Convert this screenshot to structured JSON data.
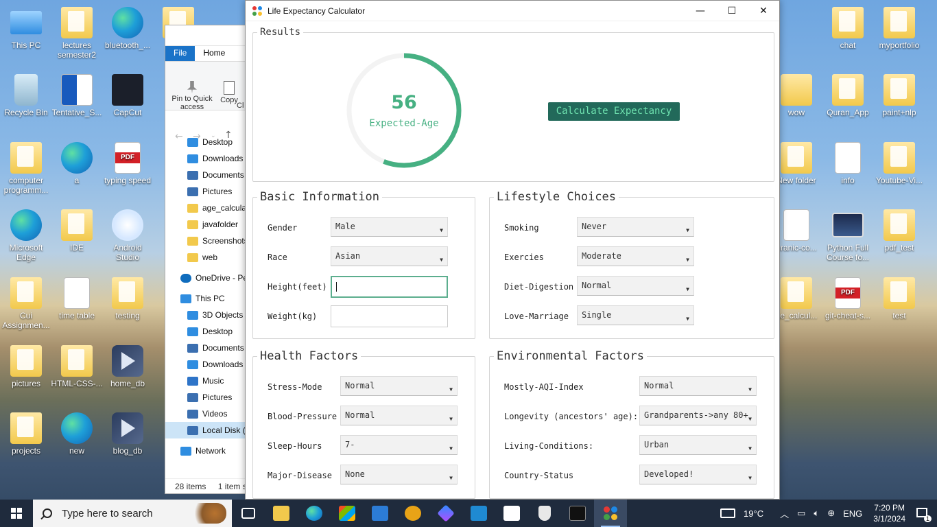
{
  "desktop": {
    "icons_left": [
      {
        "label": "This PC",
        "type": "pc"
      },
      {
        "label": "lectures semester2",
        "type": "folder"
      },
      {
        "label": "bluetooth_...",
        "type": "edge"
      },
      {
        "label": "p",
        "type": "folder"
      },
      {
        "label": "Recycle Bin",
        "type": "bin"
      },
      {
        "label": "Tentative_S...",
        "type": "word"
      },
      {
        "label": "CapCut",
        "type": "dark"
      },
      {
        "label": "computer programm...",
        "type": "folder"
      },
      {
        "label": "a",
        "type": "edge"
      },
      {
        "label": "typing speed",
        "type": "pdf"
      },
      {
        "label": "Microsoft Edge",
        "type": "edge"
      },
      {
        "label": "IDE",
        "type": "folder"
      },
      {
        "label": "Android Studio",
        "type": "studio"
      },
      {
        "label": "Cui Assignmen...",
        "type": "folder"
      },
      {
        "label": "time table",
        "type": "doc"
      },
      {
        "label": "testing",
        "type": "folder"
      },
      {
        "label": "pictures",
        "type": "folder"
      },
      {
        "label": "HTML-CSS-...",
        "type": "folder"
      },
      {
        "label": "home_db",
        "type": "gem"
      },
      {
        "label": "projects",
        "type": "folder"
      },
      {
        "label": "new",
        "type": "edge"
      },
      {
        "label": "blog_db",
        "type": "gem"
      }
    ],
    "icons_right": [
      {
        "label": "chat",
        "type": "folder"
      },
      {
        "label": "myportfolio",
        "type": "folder"
      },
      {
        "label": "wow",
        "type": "js"
      },
      {
        "label": "Quran_App",
        "type": "folder"
      },
      {
        "label": "paint+nlp",
        "type": "folder"
      },
      {
        "label": "New folder",
        "type": "folder"
      },
      {
        "label": "info",
        "type": "doc"
      },
      {
        "label": "Youtube-Vi...",
        "type": "folder"
      },
      {
        "label": "uranic-co...",
        "type": "doc"
      },
      {
        "label": "Python Full Course fo...",
        "type": "vid"
      },
      {
        "label": "pdf_test",
        "type": "folder"
      },
      {
        "label": "ge_calcul...",
        "type": "folder"
      },
      {
        "label": "git-cheat-s...",
        "type": "pdf"
      },
      {
        "label": "test",
        "type": "folder"
      }
    ]
  },
  "explorer": {
    "tabs": [
      "File",
      "Home"
    ],
    "ribbon": {
      "pin": "Pin to Quick access",
      "copy": "Copy",
      "cl": "Cl"
    },
    "nav_items": [
      {
        "label": "Desktop",
        "icon": "blue",
        "top": false
      },
      {
        "label": "Downloads",
        "icon": "blue",
        "top": false
      },
      {
        "label": "Documents",
        "icon": "gray",
        "top": false
      },
      {
        "label": "Pictures",
        "icon": "gray",
        "top": false
      },
      {
        "label": "age_calculat",
        "icon": "folder",
        "top": false
      },
      {
        "label": "javafolder",
        "icon": "folder",
        "top": false
      },
      {
        "label": "Screenshots",
        "icon": "folder",
        "top": false
      },
      {
        "label": "web",
        "icon": "folder",
        "top": false
      },
      {
        "label": "OneDrive - Pe",
        "icon": "cloud",
        "top": true
      },
      {
        "label": "This PC",
        "icon": "blue",
        "top": true
      },
      {
        "label": "3D Objects",
        "icon": "blue",
        "top": false
      },
      {
        "label": "Desktop",
        "icon": "blue",
        "top": false
      },
      {
        "label": "Documents",
        "icon": "gray",
        "top": false
      },
      {
        "label": "Downloads",
        "icon": "blue",
        "top": false
      },
      {
        "label": "Music",
        "icon": "music",
        "top": false
      },
      {
        "label": "Pictures",
        "icon": "gray",
        "top": false
      },
      {
        "label": "Videos",
        "icon": "gray",
        "top": false
      },
      {
        "label": "Local Disk (C",
        "icon": "gray",
        "top": false,
        "selected": true
      },
      {
        "label": "Network",
        "icon": "blue",
        "top": true
      }
    ],
    "status": {
      "items": "28 items",
      "selected": "1 item s"
    }
  },
  "app": {
    "title": "Life Expectancy Calculator",
    "window_buttons": {
      "minimize": "—",
      "maximize": "☐",
      "close": "✕"
    },
    "results": {
      "legend": "Results",
      "value": "56",
      "label": "Expected-Age",
      "progress_fraction": 0.56,
      "button": "Calculate Expectancy"
    },
    "basic": {
      "legend": "Basic Information",
      "gender_label": "Gender",
      "gender_value": "Male",
      "race_label": "Race",
      "race_value": "Asian",
      "height_label": "Height(feet)",
      "height_value": "",
      "weight_label": "Weight(kg)",
      "weight_value": ""
    },
    "lifestyle": {
      "legend": "Lifestyle Choices",
      "smoking_label": "Smoking",
      "smoking_value": "Never",
      "exercise_label": "Exercies",
      "exercise_value": "Moderate",
      "diet_label": "Diet-Digestion",
      "diet_value": "Normal",
      "love_label": "Love-Marriage",
      "love_value": "Single"
    },
    "health": {
      "legend": "Health Factors",
      "stress_label": "Stress-Mode",
      "stress_value": "Normal",
      "bp_label": "Blood-Pressure",
      "bp_value": "Normal",
      "sleep_label": "Sleep-Hours",
      "sleep_value": "7-",
      "disease_label": "Major-Disease",
      "disease_value": "None"
    },
    "environment": {
      "legend": "Environmental Factors",
      "aqi_label": "Mostly-AQI-Index",
      "aqi_value": "Normal",
      "longevity_label": "Longevity (ancestors' age):",
      "longevity_value": "Grandparents->any 80+",
      "living_label": "Living-Conditions:",
      "living_value": "Urban",
      "country_label": "Country-Status",
      "country_value": "Developed!"
    },
    "colors": {
      "accent": "#46b082",
      "button_bg": "#22695a",
      "button_text": "#6fe3b0"
    }
  },
  "taskbar": {
    "search_placeholder": "Type here to search",
    "weather": "19°C",
    "language": "ENG",
    "time": "7:20 PM",
    "date": "3/1/2024",
    "notification_count": "1"
  }
}
